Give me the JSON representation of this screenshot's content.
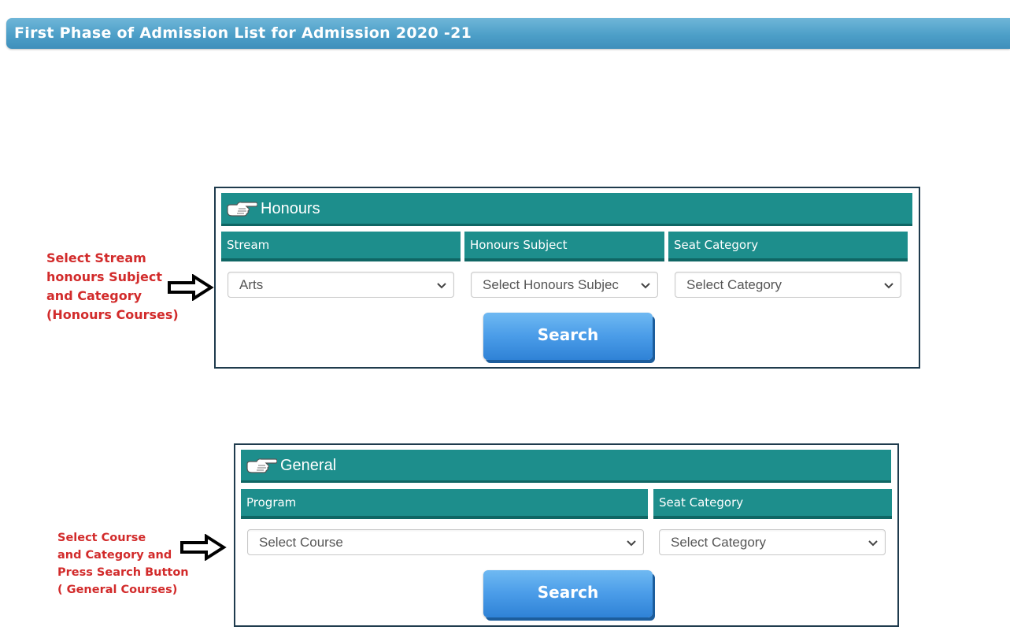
{
  "page": {
    "title": "First Phase of Admission List for Admission 2020 -21"
  },
  "honours": {
    "heading": "Honours",
    "columns": [
      "Stream",
      "Honours Subject",
      "Seat Category"
    ],
    "stream_value": "Arts",
    "subject_value": "Select Honours Subjec",
    "category_value": "Select Category",
    "search_label": "Search",
    "note_lines": [
      "Select Stream",
      "honours Subject",
      "and Category",
      "(Honours Courses)"
    ]
  },
  "general": {
    "heading": "General",
    "columns": [
      "Program",
      "Seat Category"
    ],
    "program_value": "Select Course",
    "category_value": "Select Category",
    "search_label": "Search",
    "note_lines": [
      "Select Course",
      "and Category and",
      "Press Search Button",
      "( General Courses)"
    ]
  },
  "colors": {
    "title_bar": "#4d9fc8",
    "panel_teal": "#1d8e8c",
    "panel_border": "#1f3b4d",
    "search_blue": "#4a9ce8",
    "note_red": "#d22b2b"
  },
  "icons": [
    "pointing-hand-icon",
    "chevron-down-icon",
    "right-arrow-icon"
  ]
}
